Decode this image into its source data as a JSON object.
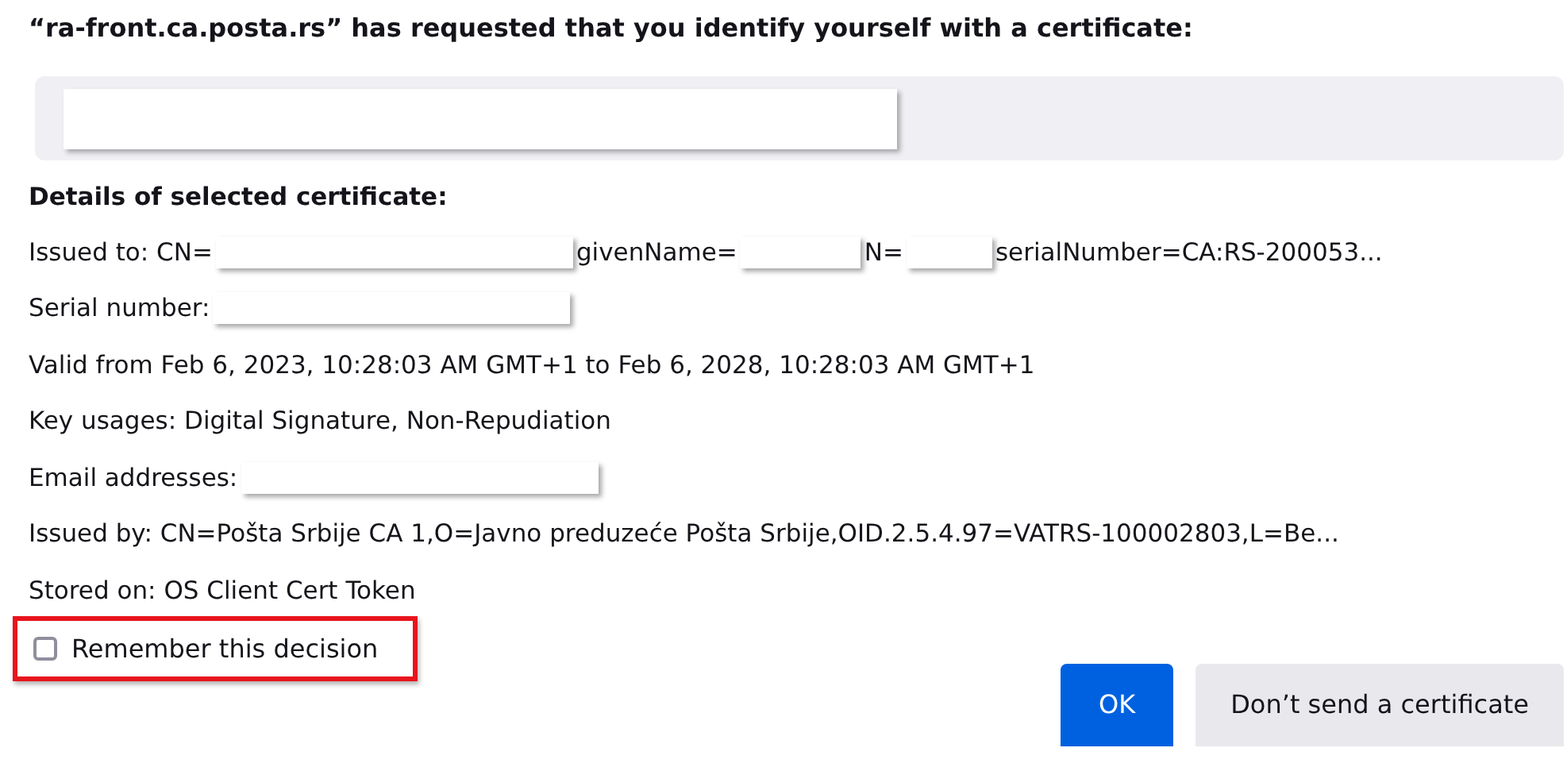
{
  "prompt": "“ra-front.ca.posta.rs” has requested that you identify yourself with a certificate:",
  "details_heading": "Details of selected certificate:",
  "details": [
    {
      "parts": [
        {
          "kind": "text",
          "text": "Issued to: CN="
        },
        {
          "kind": "redaction"
        },
        {
          "kind": "text",
          "text": "givenName="
        },
        {
          "kind": "redaction"
        },
        {
          "kind": "text",
          "text": "N="
        },
        {
          "kind": "redaction"
        },
        {
          "kind": "text",
          "text": "serialNumber=CA:RS-200053..."
        }
      ]
    },
    {
      "parts": [
        {
          "kind": "text",
          "text": "Serial number:"
        },
        {
          "kind": "redaction"
        }
      ]
    },
    {
      "parts": [
        {
          "kind": "text",
          "text": "Valid from Feb 6, 2023, 10:28:03 AM GMT+1 to Feb 6, 2028, 10:28:03 AM GMT+1"
        }
      ]
    },
    {
      "parts": [
        {
          "kind": "text",
          "text": "Key usages: Digital Signature, Non-Repudiation"
        }
      ]
    },
    {
      "parts": [
        {
          "kind": "text",
          "text": "Email addresses:"
        },
        {
          "kind": "redaction"
        }
      ]
    },
    {
      "parts": [
        {
          "kind": "text",
          "text": "Issued by: CN=Pošta Srbije CA 1,O=Javno preduzeće Pošta Srbije,OID.2.5.4.97=VATRS-100002803,L=Be..."
        }
      ]
    },
    {
      "parts": [
        {
          "kind": "text",
          "text": "Stored on: OS Client Cert Token"
        }
      ]
    }
  ],
  "remember": {
    "label": "Remember this decision",
    "checked": false,
    "highlighted": true
  },
  "buttons": [
    {
      "label": "OK",
      "kind": "primary"
    },
    {
      "label": "Don’t send a certificate",
      "kind": "secondary"
    }
  ]
}
